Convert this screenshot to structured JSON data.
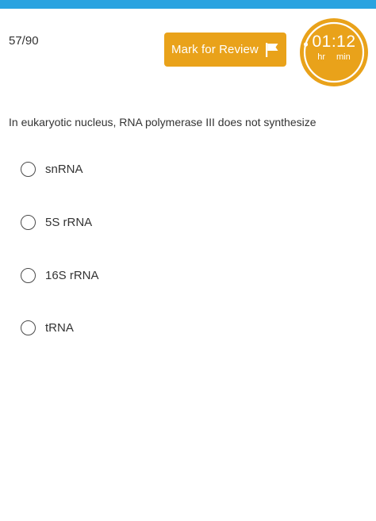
{
  "colors": {
    "top_bar": "#2aa3e0",
    "accent": "#e9a21a"
  },
  "header": {
    "question_counter": "57/90",
    "review_button": {
      "label": "Mark for Review",
      "icon": "flag-icon"
    },
    "timer": {
      "time": "01:12",
      "hours_label": "hr",
      "minutes_label": "min"
    }
  },
  "question": {
    "text": "In eukaryotic nucleus, RNA polymerase III does not synthesize",
    "options": [
      {
        "label": "snRNA",
        "selected": false
      },
      {
        "label": "5S rRNA",
        "selected": false
      },
      {
        "label": "16S rRNA",
        "selected": false
      },
      {
        "label": "tRNA",
        "selected": false
      }
    ]
  }
}
